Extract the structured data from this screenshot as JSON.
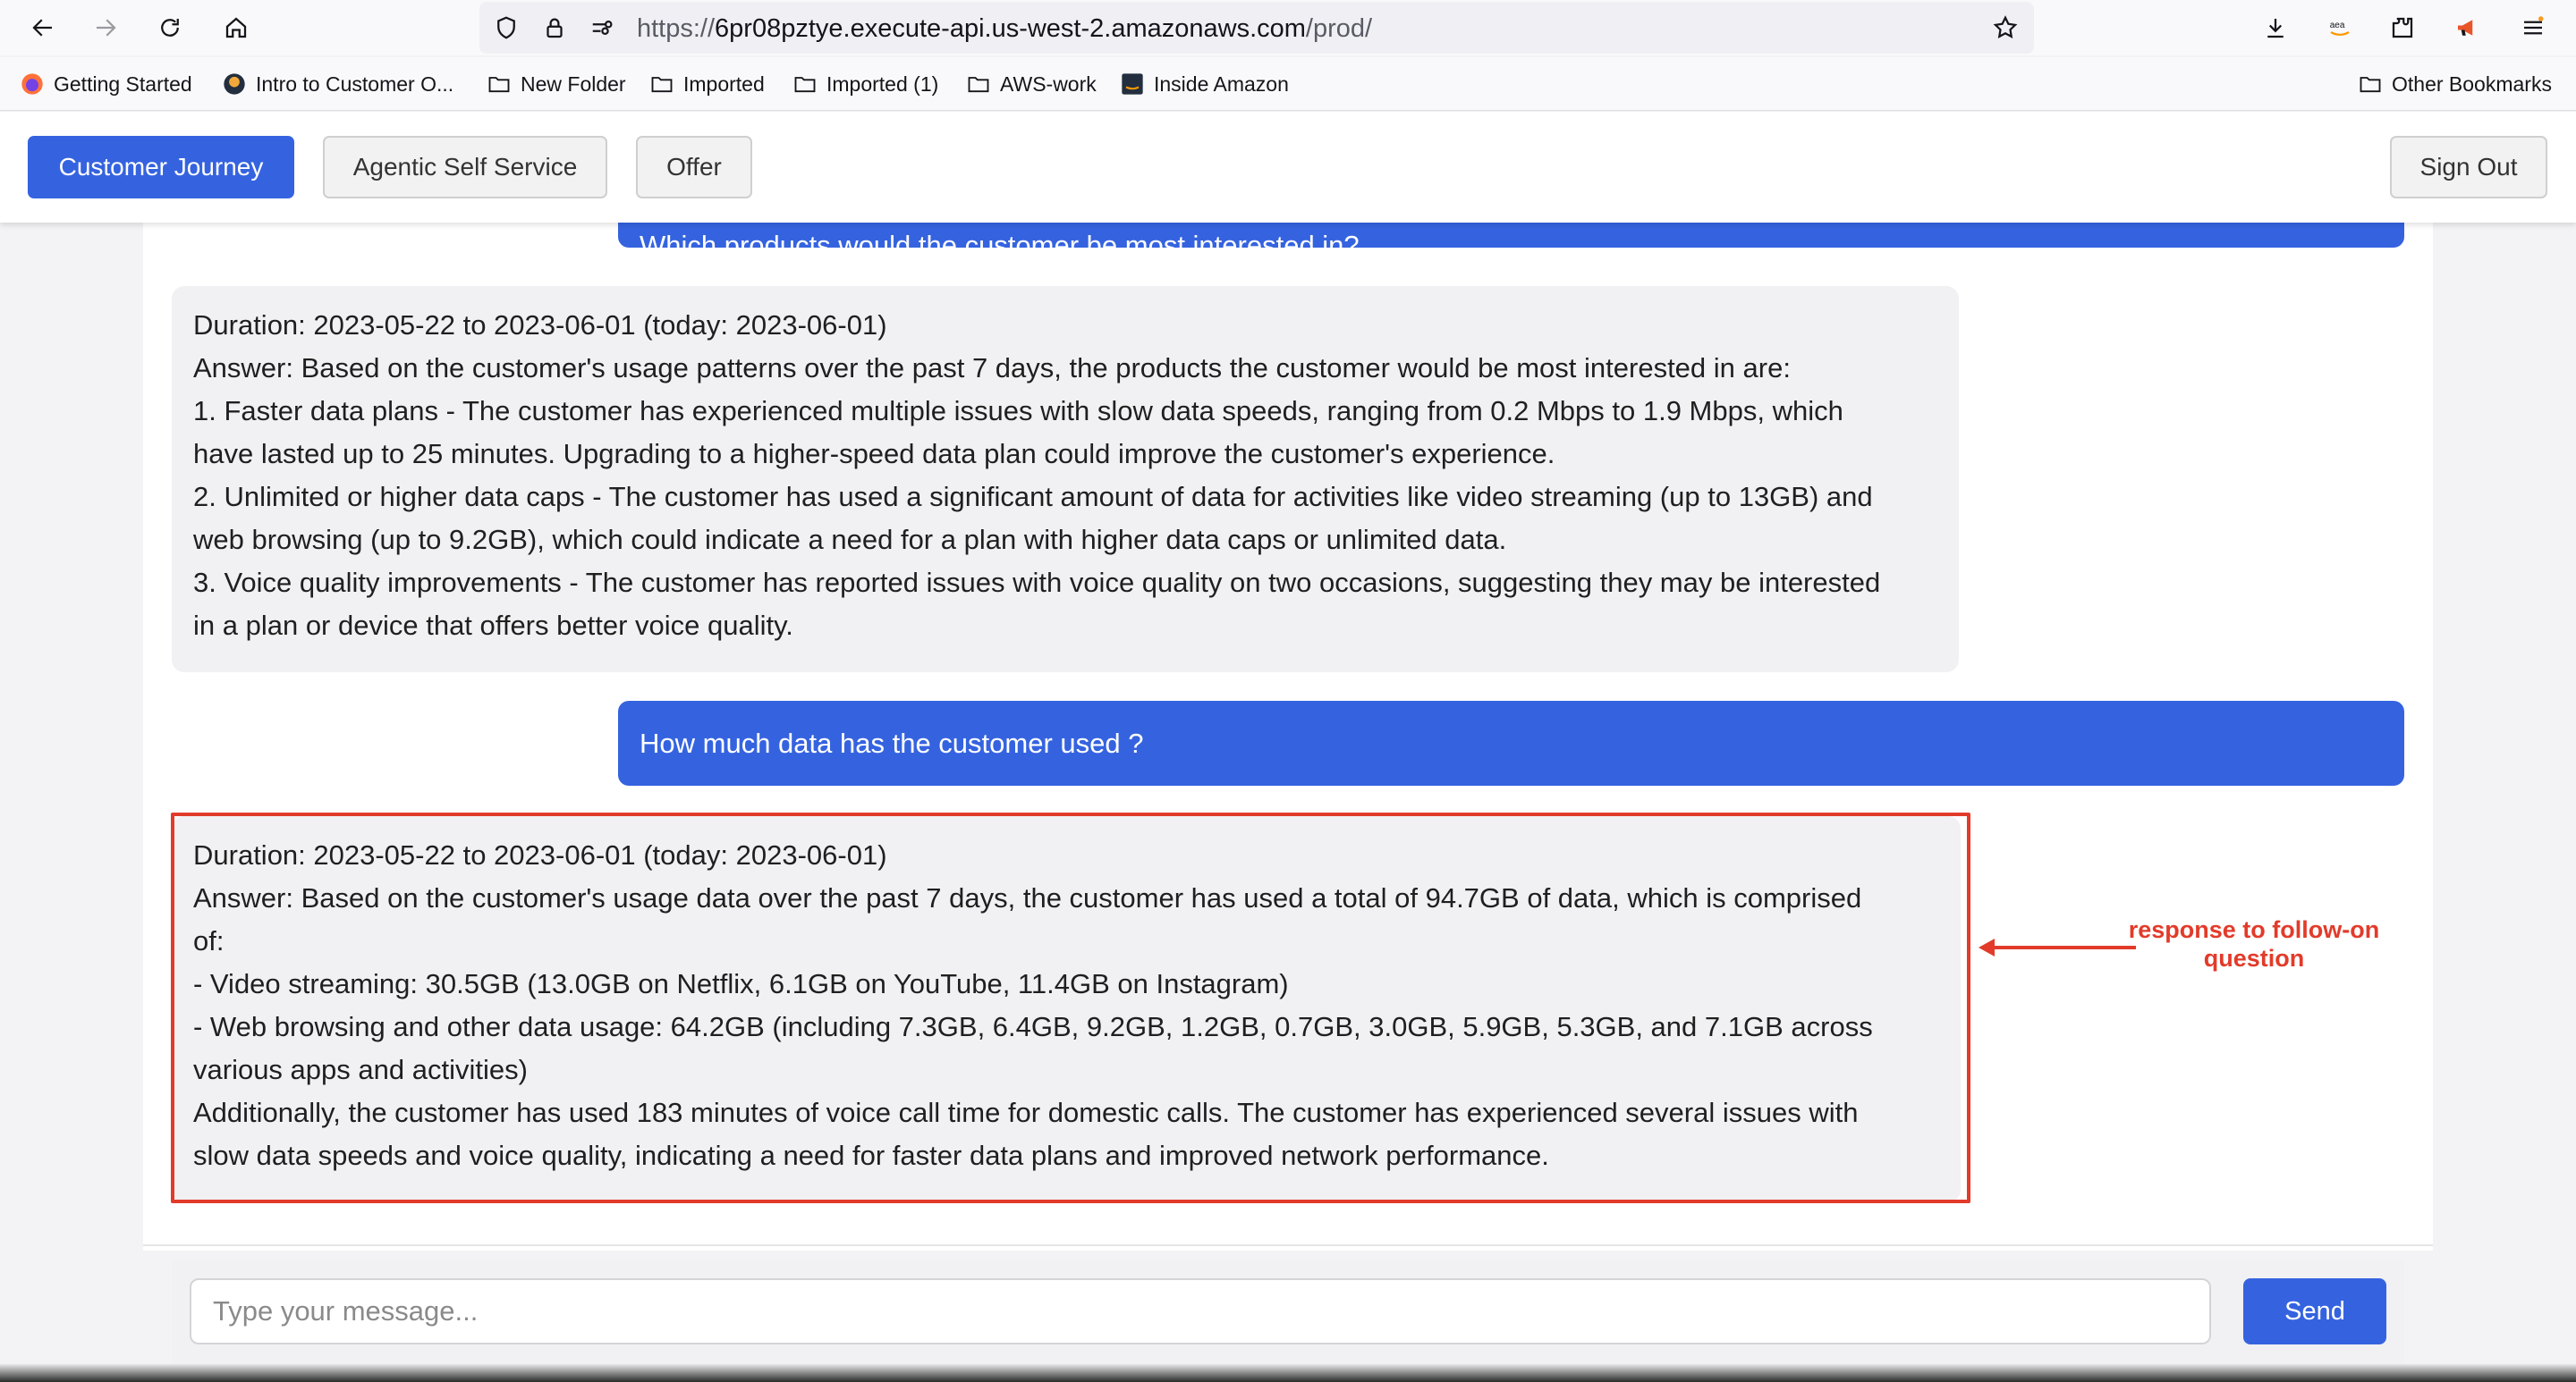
{
  "browser": {
    "url_prefix": "https://",
    "url_host": "6pr08pztye.execute-api.us-west-2.amazonaws.com",
    "url_path": "/prod/",
    "ext_label": "aea"
  },
  "bookmarks": [
    {
      "label": "Getting Started",
      "icon": "firefox-icon"
    },
    {
      "label": "Intro to Customer O...",
      "icon": "site-favicon"
    },
    {
      "label": "New Folder",
      "icon": "folder-icon"
    },
    {
      "label": "Imported",
      "icon": "folder-icon"
    },
    {
      "label": "Imported (1)",
      "icon": "folder-icon"
    },
    {
      "label": "AWS-work",
      "icon": "folder-icon"
    },
    {
      "label": "Inside Amazon",
      "icon": "amazon-icon"
    },
    {
      "label": "Other Bookmarks",
      "icon": "folder-icon"
    }
  ],
  "header": {
    "tabs": [
      {
        "label": "Customer Journey",
        "active": true
      },
      {
        "label": "Agentic Self Service",
        "active": false
      },
      {
        "label": "Offer",
        "active": false
      }
    ],
    "sign_out": "Sign Out"
  },
  "chat": {
    "partial_user_message": "Which products would the customer be most interested in?",
    "bot_message_1": [
      "Duration: 2023-05-22 to 2023-06-01 (today: 2023-06-01)",
      "Answer: Based on the customer's usage patterns over the past 7 days, the products the customer would be most interested in are:",
      "1. Faster data plans - The customer has experienced multiple issues with slow data speeds, ranging from 0.2 Mbps to 1.9 Mbps, which",
      "have lasted up to 25 minutes. Upgrading to a higher-speed data plan could improve the customer's experience.",
      "2. Unlimited or higher data caps - The customer has used a significant amount of data for activities like video streaming (up to 13GB) and",
      "web browsing (up to 9.2GB), which could indicate a need for a plan with higher data caps or unlimited data.",
      "3. Voice quality improvements - The customer has reported issues with voice quality on two occasions, suggesting they may be interested",
      "in a plan or device that offers better voice quality."
    ],
    "user_message_2": "How much data has the customer used ?",
    "bot_message_2": [
      "Duration: 2023-05-22 to 2023-06-01 (today: 2023-06-01)",
      "Answer: Based on the customer's usage data over the past 7 days, the customer has used a total of 94.7GB of data, which is comprised",
      "of:",
      "- Video streaming: 30.5GB (13.0GB on Netflix, 6.1GB on YouTube, 11.4GB on Instagram)",
      "- Web browsing and other data usage: 64.2GB (including 7.3GB, 6.4GB, 9.2GB, 1.2GB, 0.7GB, 3.0GB, 5.9GB, 5.3GB, and 7.1GB across",
      "various apps and activities)",
      "Additionally, the customer has used 183 minutes of voice call time for domestic calls. The customer has experienced several issues with",
      "slow data speeds and voice quality, indicating a need for faster data plans and improved network performance."
    ],
    "annotation": [
      "response to follow-on",
      "question"
    ]
  },
  "composer": {
    "placeholder": "Type your message...",
    "send_label": "Send"
  },
  "colors": {
    "accent": "#3563e0",
    "annotation_red": "#e23b2a"
  }
}
